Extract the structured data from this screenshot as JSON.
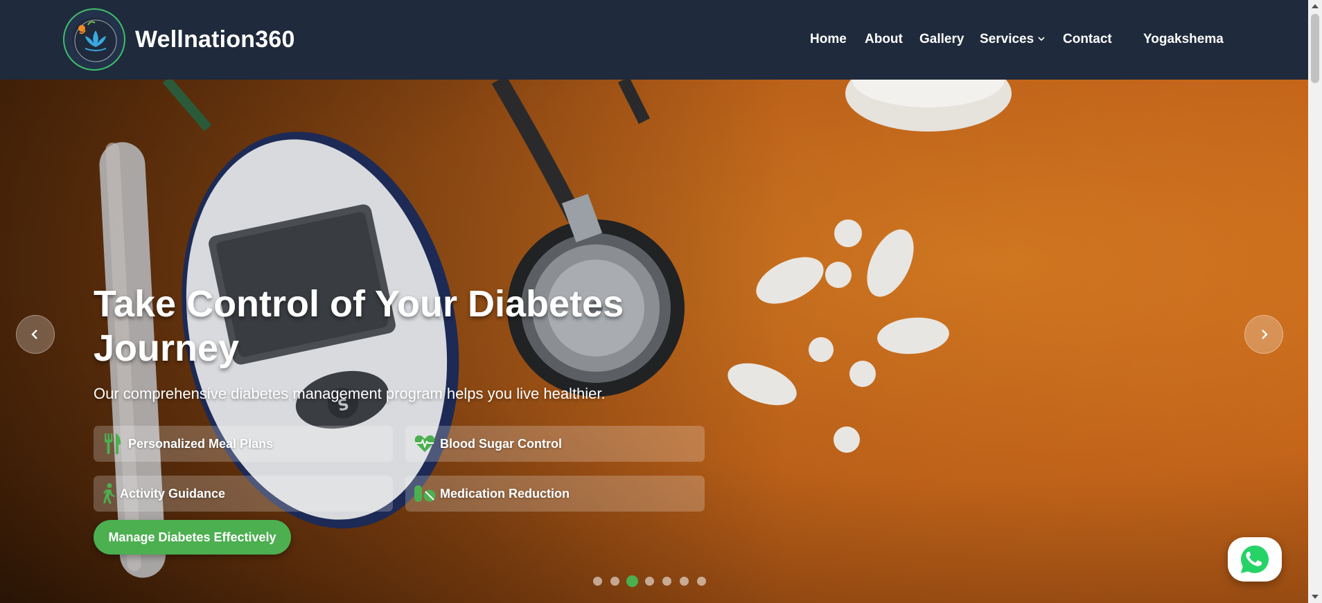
{
  "header": {
    "brand": "Wellnation360",
    "nav": [
      {
        "label": "Home"
      },
      {
        "label": "About"
      },
      {
        "label": "Gallery"
      },
      {
        "label": "Services",
        "has_dropdown": true
      },
      {
        "label": "Contact"
      },
      {
        "label": "Yogakshema"
      }
    ],
    "colors": {
      "background": "#1f2a3c",
      "accent": "#3fbf6a"
    }
  },
  "hero": {
    "title": "Take Control of Your Diabetes Journey",
    "subtitle": "Our comprehensive diabetes management program helps you live healthier.",
    "features": [
      {
        "label": "Personalized Meal Plans",
        "icon": "utensils-icon"
      },
      {
        "label": "Blood Sugar Control",
        "icon": "heartbeat-icon"
      },
      {
        "label": "Activity Guidance",
        "icon": "walking-icon"
      },
      {
        "label": "Medication Reduction",
        "icon": "pills-icon"
      }
    ],
    "cta_label": "Manage Diabetes Effectively",
    "carousel": {
      "slide_count": 7,
      "active_index": 2
    },
    "colors": {
      "accent": "#4caf50"
    }
  },
  "whatsapp": {
    "icon": "whatsapp-icon",
    "color": "#25d366"
  }
}
